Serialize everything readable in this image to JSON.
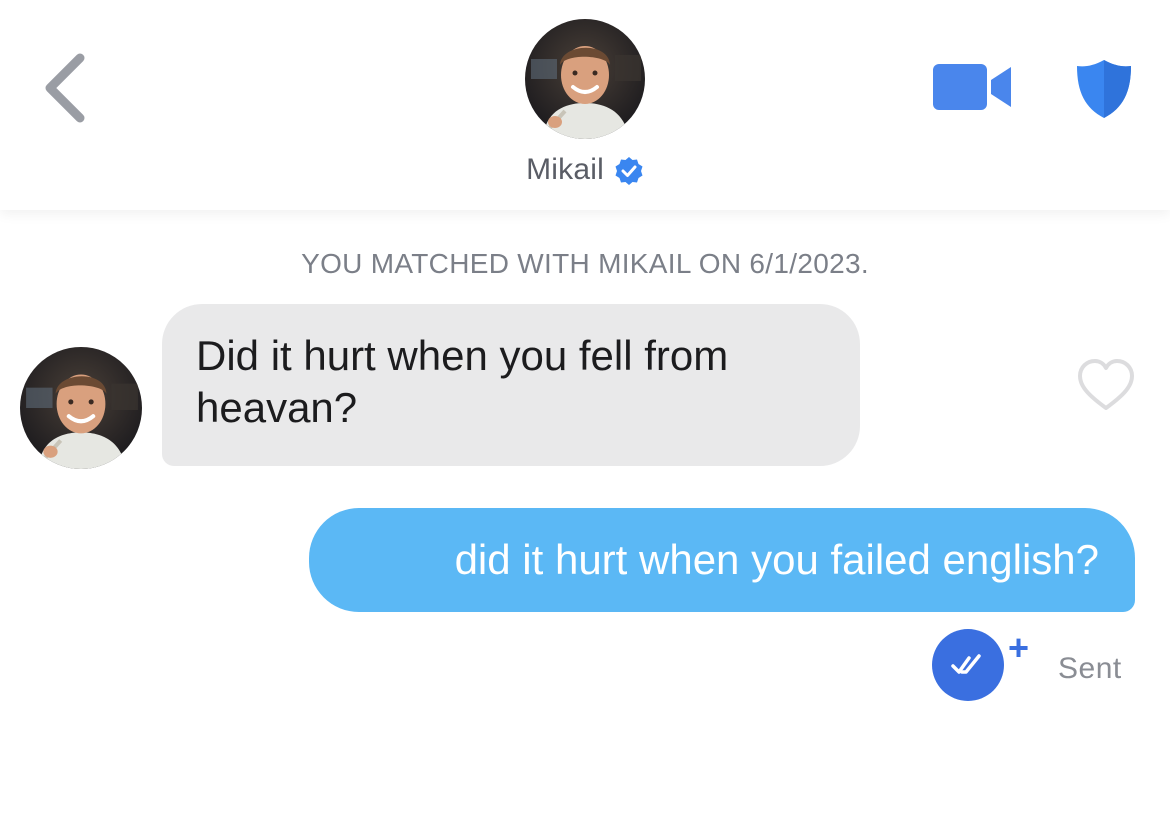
{
  "header": {
    "back_icon": "chevron-left-icon",
    "avatar_icon": "profile-photo",
    "name": "Mikail",
    "verified_icon": "verified-badge-icon",
    "video_icon": "video-camera-icon",
    "safety_icon": "shield-icon"
  },
  "conversation": {
    "match_note": "YOU MATCHED WITH MIKAIL ON 6/1/2023.",
    "messages": [
      {
        "direction": "incoming",
        "text": "Did it hurt when you fell from heavan?",
        "like_icon": "heart-outline-icon"
      },
      {
        "direction": "outgoing",
        "text": "did it hurt when you failed english?",
        "receipt_icon": "double-check-icon",
        "receipt_plus": "+",
        "status": "Sent"
      }
    ]
  },
  "colors": {
    "accent_blue": "#4a86ec",
    "outgoing_bubble": "#5bb8f5",
    "incoming_bubble": "#e9e9ea",
    "muted_text": "#7b7f88",
    "back_chevron": "#9a9da4"
  }
}
